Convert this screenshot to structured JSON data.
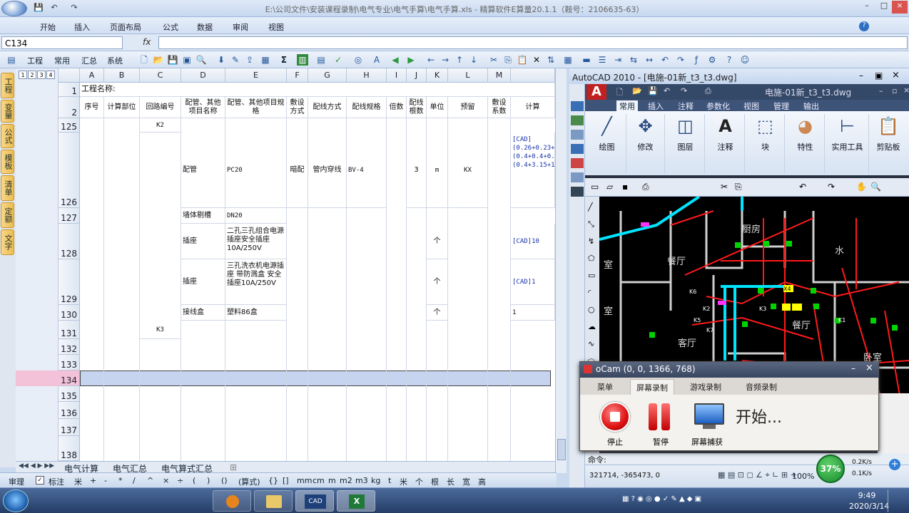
{
  "excel": {
    "title": "E:\\公司文件\\安装课程录制\\电气专业\\电气手算\\电气手算.xls - 精算软件E算量20.1.1（鞍号：2106635-63）",
    "menu": [
      "开始",
      "插入",
      "页面布局",
      "公式",
      "数据",
      "审阅",
      "视图"
    ],
    "name_box": "C134",
    "fx": "fx",
    "toolbar_labels": [
      "工程",
      "常用",
      "汇总",
      "系统"
    ],
    "toolbar_sigma": "Σ",
    "left_tabs": [
      "工程",
      "变量",
      "公式",
      "模板",
      "清单",
      "定额",
      "文字"
    ],
    "outline_levels": [
      "1",
      "2",
      "3",
      "4"
    ],
    "columns": [
      "A",
      "B",
      "C",
      "D",
      "E",
      "F",
      "G",
      "H",
      "I",
      "J",
      "K",
      "L",
      "M"
    ],
    "row1_title": "工程名称:",
    "headers": [
      "序号",
      "计算部位",
      "回路编号",
      "配管、其他项目名称",
      "配管、其他项目规格",
      "敷设方式",
      "配线方式",
      "配线规格",
      "倍数",
      "配线根数",
      "单位",
      "预留",
      "敷设系数",
      "计算"
    ],
    "rows": [
      {
        "num": "125",
        "C": "K2"
      },
      {
        "num": "126",
        "D": "配管",
        "E": "PC20",
        "F": "暗配",
        "G": "管内穿线",
        "H": "BV-4",
        "J": "3",
        "K": "m",
        "L": "KX",
        "M": "[CAD](0.26+0.23+2.69+0.23)+(0.4+0.4+0.21+0.2+1+1.98+0.2+(0.4+3.15+1+0.75+0.7"
      },
      {
        "num": "127",
        "D": "墙体剔槽",
        "E": "DN20"
      },
      {
        "num": "128",
        "D": "插座",
        "E": "二孔三孔组合电源插座安全插座10A/250V",
        "K": "个",
        "M": "[CAD]10"
      },
      {
        "num": "129",
        "D": "插座",
        "E": "三孔洗衣机电源插座 带防溅盒 安全插座10A/250V",
        "K": "个",
        "M": "[CAD]1"
      },
      {
        "num": "130",
        "D": "接线盒",
        "E": "塑料86盒",
        "K": "个",
        "M": "1"
      },
      {
        "num": "131",
        "C": "K3"
      },
      {
        "num": "132"
      },
      {
        "num": "133"
      },
      {
        "num": "134"
      },
      {
        "num": "135"
      },
      {
        "num": "136"
      },
      {
        "num": "137"
      },
      {
        "num": "138"
      }
    ],
    "sheet_tabs": [
      "电气计算",
      "电气汇总",
      "电气算式汇总"
    ],
    "status_items": [
      "审理",
      "标注",
      "米",
      "+",
      "-",
      "*",
      "/",
      "^",
      "×",
      "÷",
      "(",
      ")",
      "()",
      "(算式)",
      "{}",
      "[]",
      "mm",
      "cm",
      "m",
      "m2",
      "m3",
      "kg",
      "t",
      "米",
      "个",
      "根",
      "长",
      "宽",
      "高"
    ]
  },
  "autocad": {
    "title": "AutoCAD 2010 - [电施-01新_t3_t3.dwg]",
    "doc_name": "电施-01新_t3_t3.dwg",
    "ribbon_tabs": [
      "常用",
      "插入",
      "注释",
      "参数化",
      "视图",
      "管理",
      "输出"
    ],
    "ribbon_buttons": [
      "绘图",
      "修改",
      "图层",
      "注释",
      "块",
      "特性",
      "实用工具",
      "剪贴板"
    ],
    "drawing_labels": [
      "厨房",
      "餐厅",
      "客厅",
      "卧室",
      "室",
      "K1",
      "K2",
      "K3",
      "K5",
      "K6",
      "K7",
      "X4",
      "水"
    ],
    "command": "命令:",
    "coords": "321714, -365473, 0",
    "zoom": "100%",
    "cpu": "37%",
    "net_up": "0.2K/s",
    "net_down": "0.1K/s"
  },
  "ocam": {
    "title": "oCam (0, 0, 1366, 768)",
    "tabs": [
      "菜单",
      "屏幕录制",
      "游戏录制",
      "音频录制"
    ],
    "stop_label": "停止",
    "pause_label": "暂停",
    "capture_label": "屏幕捕获",
    "start_label": "开始..."
  },
  "taskbar": {
    "time": "9:49",
    "date": "2020/3/14"
  }
}
